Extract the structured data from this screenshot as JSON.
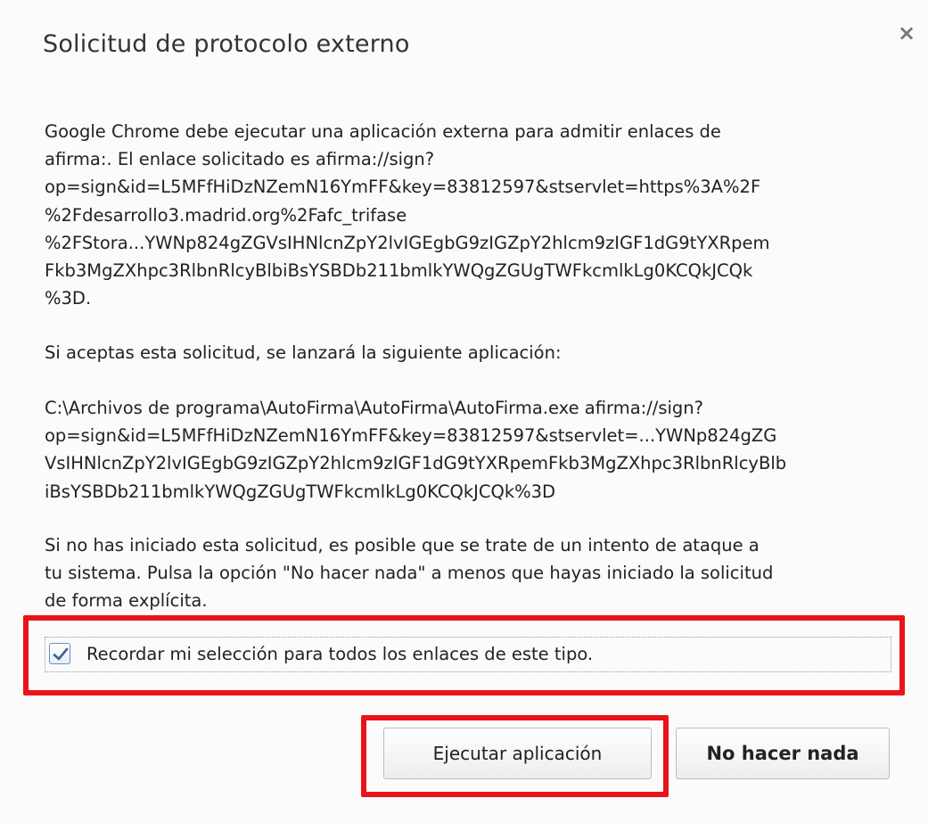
{
  "dialog": {
    "title": "Solicitud de protocolo externo",
    "close_glyph": "×",
    "paragraph_1": "Google Chrome debe ejecutar una aplicación externa para admitir enlaces de\nafirma:. El enlace solicitado es afirma://sign?\nop=sign&id=L5MFfHiDzNZemN16YmFF&key=83812597&stservlet=https%3A%2F\n%2Fdesarrollo3.madrid.org%2Fafc_trifase\n%2FStora...YWNp824gZGVsIHNlcnZpY2lvIGEgbG9zIGZpY2hlcm9zIGF1dG9tYXRpem\nFkb3MgZXhpc3RlbnRlcyBlbiBsYSBDb211bmlkYWQgZGUgTWFkcmlkLg0KCQkJCQk\n%3D.",
    "paragraph_2": "Si aceptas esta solicitud, se lanzará la siguiente aplicación:",
    "paragraph_3": " C:\\Archivos de programa\\AutoFirma\\AutoFirma\\AutoFirma.exe afirma://sign?\nop=sign&id=L5MFfHiDzNZemN16YmFF&key=83812597&stservlet=...YWNp824gZG\nVsIHNlcnZpY2lvIGEgbG9zIGZpY2hlcm9zIGF1dG9tYXRpemFkb3MgZXhpc3RlbnRlcyBlb\niBsYSBDb211bmlkYWQgZGUgTWFkcmlkLg0KCQkJCQk%3D",
    "paragraph_4": "Si no has iniciado esta solicitud, es posible que se trate de un intento de ataque a\ntu sistema. Pulsa la opción \"No hacer nada\" a menos que hayas iniciado la solicitud\nde forma explícita.",
    "remember_label": "Recordar mi selección para todos los enlaces de este tipo.",
    "remember_checked": true,
    "run_button": "Ejecutar aplicación",
    "nothing_button": "No hacer nada"
  },
  "colors": {
    "highlight": "#e8141a",
    "checkmark": "#3a5f94"
  },
  "icons": {
    "close": "close-icon",
    "check": "checkmark-icon"
  }
}
